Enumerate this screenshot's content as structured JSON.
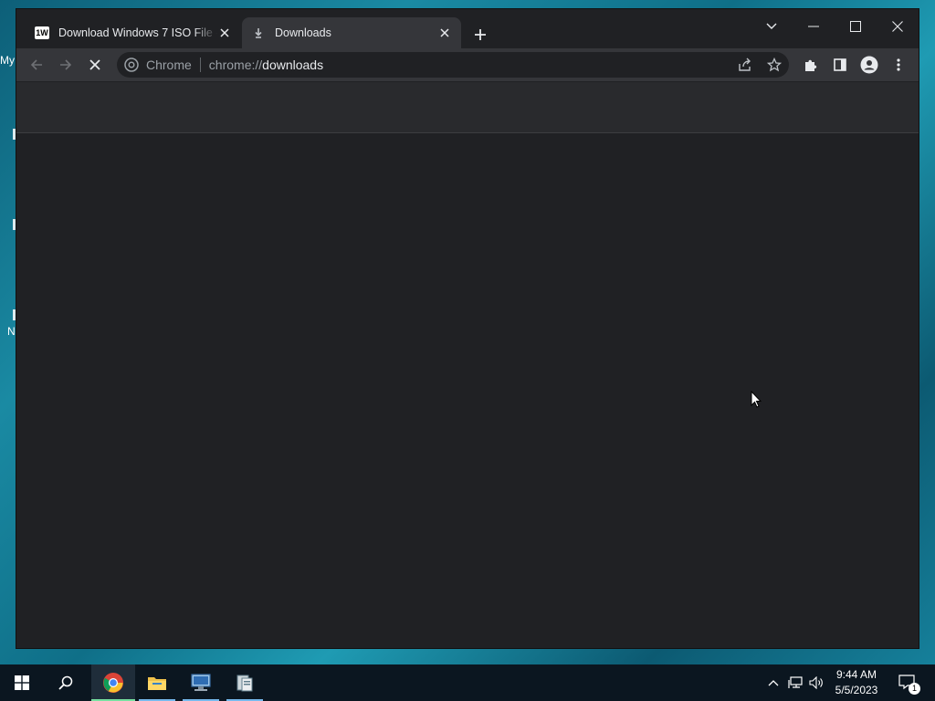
{
  "desktop": {
    "fragments": [
      "My",
      "N"
    ]
  },
  "tabs": [
    {
      "title": "Download Windows 7 ISO File - U",
      "favicon_text": "1W",
      "close_icon": "close-icon"
    },
    {
      "title": "Downloads",
      "favicon": "download-icon",
      "close_icon": "close-icon"
    }
  ],
  "omnibox": {
    "chip_label": "Chrome",
    "url_prefix": "chrome://",
    "url_path": "downloads"
  },
  "clock": {
    "time": "9:44 AM",
    "date": "5/5/2023"
  },
  "notifications": {
    "count": "1"
  },
  "colors": {
    "accent": "#76b9ed",
    "window_bg": "#202124",
    "toolbar_bg": "#35363a"
  }
}
